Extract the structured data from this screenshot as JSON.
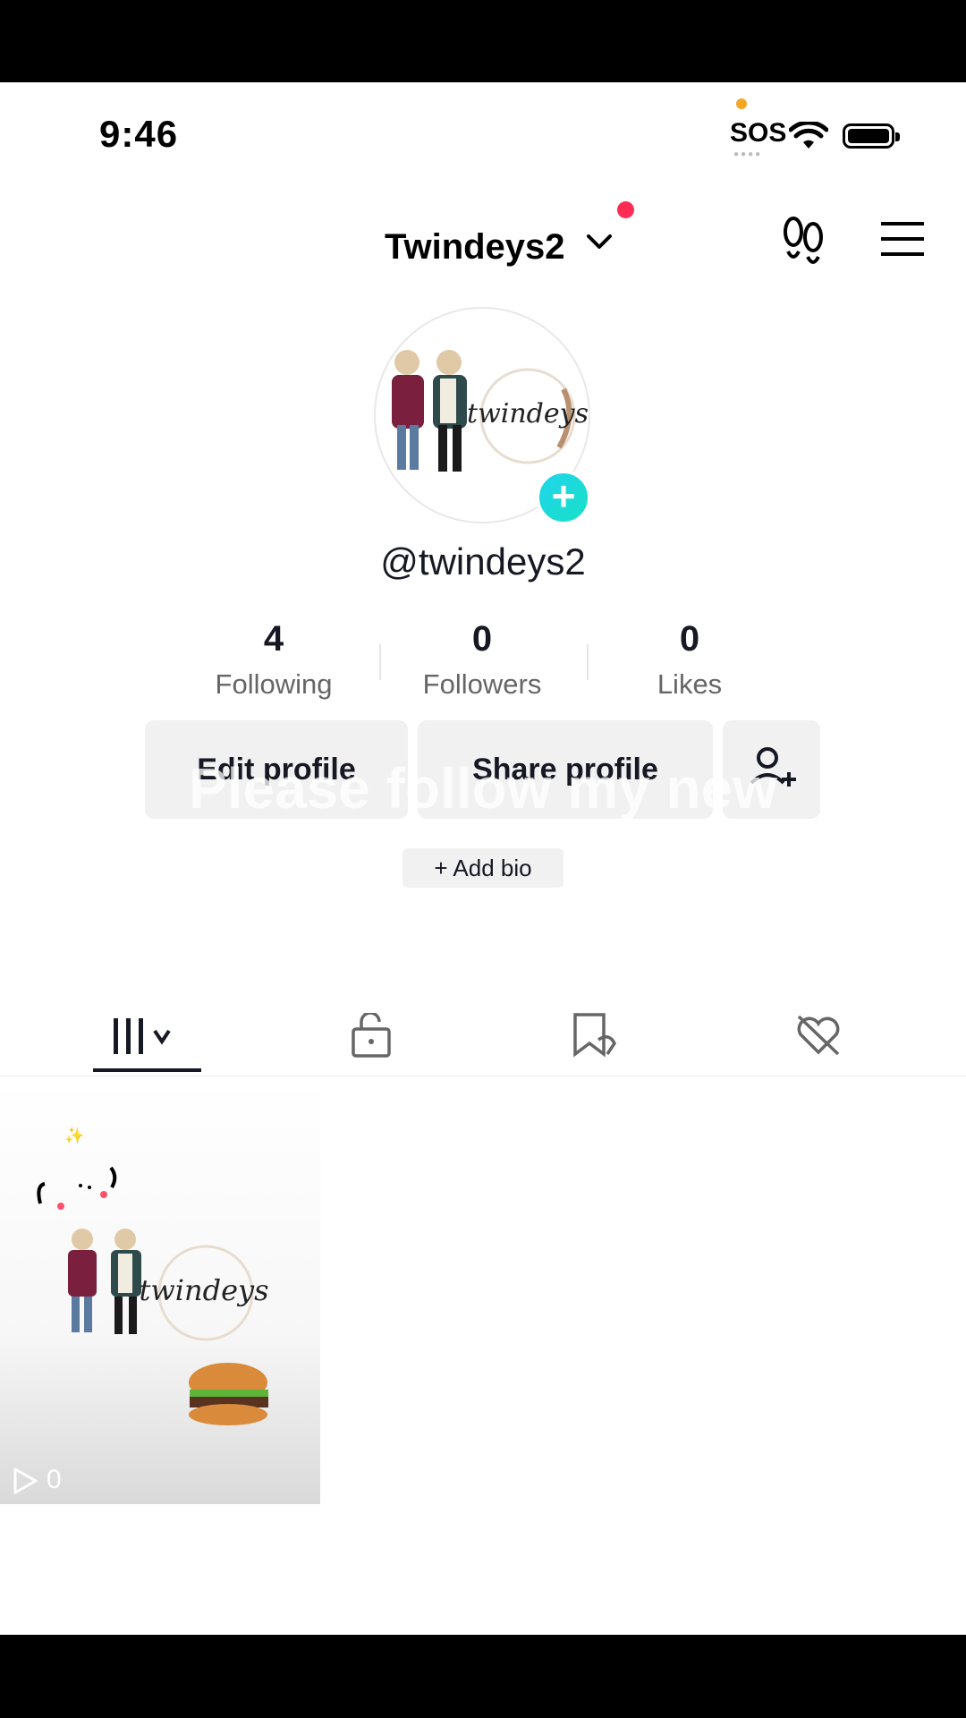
{
  "status_bar": {
    "time": "9:46",
    "sos": "SOS"
  },
  "header": {
    "account_name": "Twindeys2"
  },
  "profile": {
    "handle": "@twindeys2",
    "avatar_logo_text": "twindeys",
    "stats": [
      {
        "value": "4",
        "label": "Following"
      },
      {
        "value": "0",
        "label": "Followers"
      },
      {
        "value": "0",
        "label": "Likes"
      }
    ],
    "edit_button": "Edit profile",
    "share_button": "Share profile",
    "overlay_caption": "Please follow my new",
    "add_bio": "+ Add bio"
  },
  "tabs": [
    "videos-grid-icon",
    "lock-icon",
    "bookmark-icon",
    "liked-hidden-icon"
  ],
  "videos": [
    {
      "plays": "0",
      "logo_text": "twindeys"
    }
  ],
  "colors": {
    "accent_red": "#fe2c55",
    "accent_cyan": "#20d5ec",
    "text": "#161823",
    "button_bg": "#f1f1f2"
  }
}
